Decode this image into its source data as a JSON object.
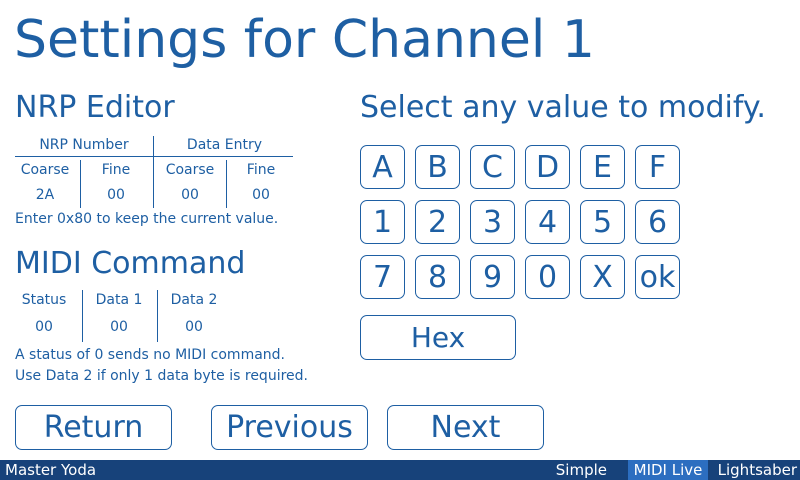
{
  "title": "Settings for Channel 1",
  "nrp": {
    "heading": "NRP Editor",
    "group_nrp_number": "NRP Number",
    "group_data_entry": "Data Entry",
    "col_headers": [
      "Coarse",
      "Fine",
      "Coarse",
      "Fine"
    ],
    "values": [
      "2A",
      "00",
      "00",
      "00"
    ],
    "note": "Enter 0x80 to keep the current value."
  },
  "midi": {
    "heading": "MIDI Command",
    "col_headers": [
      "Status",
      "Data 1",
      "Data 2"
    ],
    "values": [
      "00",
      "00",
      "00"
    ],
    "note1": "A status of 0 sends no MIDI command.",
    "note2": "Use Data 2 if only 1 data byte is required."
  },
  "keypad": {
    "prompt": "Select any value to modify.",
    "keys": [
      "A",
      "B",
      "C",
      "D",
      "E",
      "F",
      "1",
      "2",
      "3",
      "4",
      "5",
      "6",
      "7",
      "8",
      "9",
      "0",
      "X",
      "ok"
    ],
    "hex_label": "Hex"
  },
  "nav": {
    "return_label": "Return",
    "previous_label": "Previous",
    "next_label": "Next"
  },
  "status_bar": {
    "user": "Master Yoda",
    "modes": [
      "Simple",
      "MIDI Live",
      "Lightsaber"
    ],
    "active_mode": "MIDI Live",
    "colors": {
      "bar": "#17427a",
      "active": "#2c6ec0",
      "text": "#ffffff"
    }
  },
  "theme": {
    "accent": "#1e5fa3",
    "background": "#ffffff"
  }
}
